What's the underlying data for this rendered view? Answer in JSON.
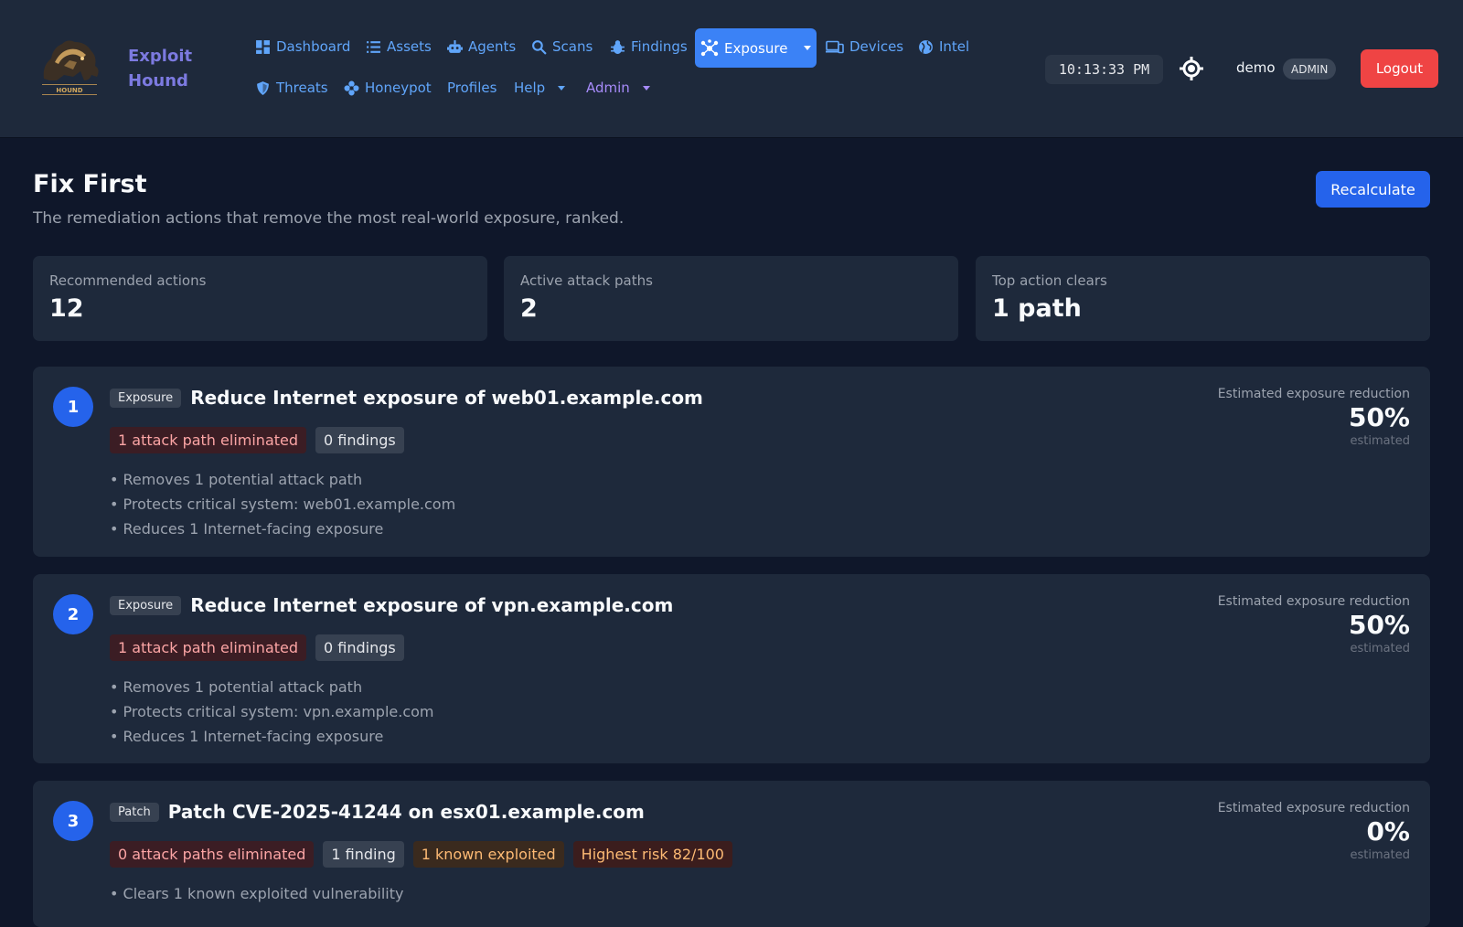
{
  "brand": {
    "name_line1": "Exploit",
    "name_line2": "Hound",
    "logo_text": "HOUND"
  },
  "nav": {
    "row1": [
      {
        "label": "Dashboard",
        "icon": "grid-icon"
      },
      {
        "label": "Assets",
        "icon": "list-icon"
      },
      {
        "label": "Agents",
        "icon": "robot-icon"
      },
      {
        "label": "Scans",
        "icon": "search-icon"
      },
      {
        "label": "Findings",
        "icon": "bug-icon"
      }
    ],
    "active": {
      "label": "Exposure",
      "icon": "network-icon"
    },
    "row1_right": [
      {
        "label": "Devices",
        "icon": "devices-icon"
      },
      {
        "label": "Intel",
        "icon": "globe-icon"
      }
    ],
    "row2": [
      {
        "label": "Threats",
        "icon": "shield-icon"
      },
      {
        "label": "Honeypot",
        "icon": "flower-icon"
      },
      {
        "label": "Profiles"
      },
      {
        "label": "Help"
      },
      {
        "label": "Admin"
      }
    ]
  },
  "clock": "10:13:33 PM",
  "user": {
    "name": "demo",
    "role": "ADMIN"
  },
  "logout_label": "Logout",
  "header": {
    "title": "Fix First",
    "subtitle": "The remediation actions that remove the most real-world exposure, ranked.",
    "recalculate_label": "Recalculate"
  },
  "stats": [
    {
      "label": "Recommended actions",
      "value": "12"
    },
    {
      "label": "Active attack paths",
      "value": "2"
    },
    {
      "label": "Top action clears",
      "value": "1 path"
    }
  ],
  "reduction_label": "Estimated exposure reduction",
  "reduction_note": "estimated",
  "actions": [
    {
      "rank": "1",
      "type": "Exposure",
      "title": "Reduce Internet exposure of web01.example.com",
      "chips": [
        "1 attack path eliminated",
        "0 findings"
      ],
      "bullets": [
        "• Removes 1 potential attack path",
        "• Protects critical system: web01.example.com",
        "• Reduces 1 Internet-facing exposure"
      ],
      "reduction": "50%"
    },
    {
      "rank": "2",
      "type": "Exposure",
      "title": "Reduce Internet exposure of vpn.example.com",
      "chips": [
        "1 attack path eliminated",
        "0 findings"
      ],
      "bullets": [
        "• Removes 1 potential attack path",
        "• Protects critical system: vpn.example.com",
        "• Reduces 1 Internet-facing exposure"
      ],
      "reduction": "50%"
    },
    {
      "rank": "3",
      "type": "Patch",
      "title": "Patch CVE-2025-41244 on esx01.example.com",
      "chips": [
        "0 attack paths eliminated",
        "1 finding",
        "1 known exploited",
        "Highest risk 82/100"
      ],
      "bullets": [
        "• Clears 1 known exploited vulnerability"
      ],
      "reduction": "0%"
    }
  ]
}
